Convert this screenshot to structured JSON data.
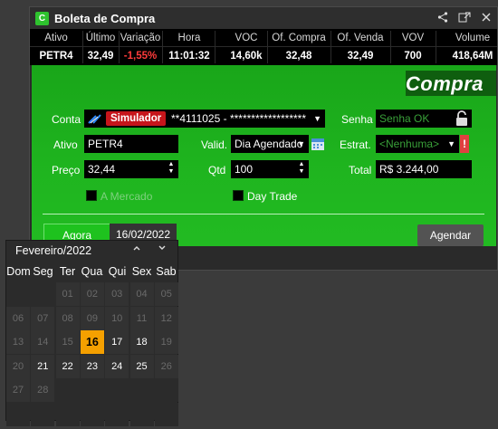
{
  "window": {
    "title": "Boleta de Compra",
    "app_icon": "C"
  },
  "quote": {
    "headers": [
      "Ativo",
      "Último",
      "Variação",
      "Hora",
      "VOC",
      "Of. Compra",
      "Of. Venda",
      "VOV",
      "Volume"
    ],
    "values": [
      "PETR4",
      "32,49",
      "-1,55%",
      "11:01:32",
      "14,60k",
      "32,48",
      "32,49",
      "700",
      "418,64M"
    ]
  },
  "form": {
    "banner": "Compra",
    "conta_label": "Conta",
    "conta_badge": "Simulador",
    "conta_value": "**4111025 - ******************",
    "senha_label": "Senha",
    "senha_value": "Senha OK",
    "ativo_label": "Ativo",
    "ativo_value": "PETR4",
    "valid_label": "Valid.",
    "valid_value": "Dia Agendado",
    "estrat_label": "Estrat.",
    "estrat_value": "<Nenhuma>",
    "estrat_warn": "!",
    "preco_label": "Preço",
    "preco_value": "32,44",
    "qtd_label": "Qtd",
    "qtd_value": "100",
    "total_label": "Total",
    "total_value": "R$ 3.244,00",
    "a_mercado_label": "A Mercado",
    "day_trade_label": "Day Trade"
  },
  "bottom": {
    "agora_tab": "Agora",
    "date_tab": "16/02/2022",
    "agendar_button": "Agendar"
  },
  "calendar": {
    "month_label": "Fevereiro/2022",
    "weekdays": [
      "Dom",
      "Seg",
      "Ter",
      "Qua",
      "Qui",
      "Sex",
      "Sab"
    ],
    "selected": "16",
    "rows": [
      [
        "",
        "",
        "01",
        "02",
        "03",
        "04",
        "05"
      ],
      [
        "06",
        "07",
        "08",
        "09",
        "10",
        "11",
        "12"
      ],
      [
        "13",
        "14",
        "15",
        "16",
        "17",
        "18",
        "19"
      ],
      [
        "20",
        "21",
        "22",
        "23",
        "24",
        "25",
        "26"
      ],
      [
        "27",
        "28",
        "",
        "",
        "",
        "",
        ""
      ],
      [
        "",
        "",
        "",
        "",
        "",
        "",
        ""
      ]
    ],
    "enabled": [
      "16",
      "17",
      "18",
      "21",
      "22",
      "23",
      "24",
      "25"
    ]
  },
  "colors": {
    "buy_green": "#1fb51f",
    "banner_green": "#0f5e0f",
    "simulator_red": "#c6151b",
    "negative": "#ff3b3b",
    "selected_day": "#f5a000"
  }
}
